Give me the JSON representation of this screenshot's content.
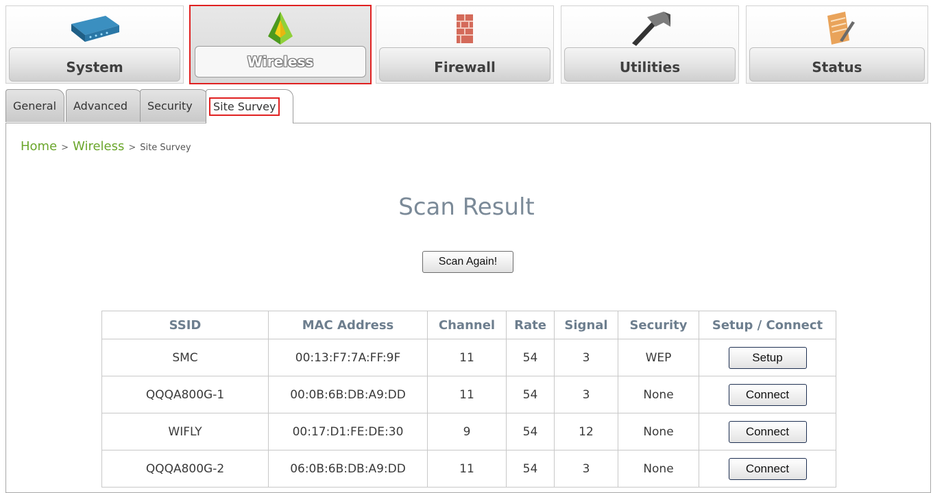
{
  "topnav": {
    "items": [
      {
        "label": "System",
        "icon": "router-icon"
      },
      {
        "label": "Wireless",
        "icon": "antenna-pyramid-icon",
        "active": true
      },
      {
        "label": "Firewall",
        "icon": "brick-wall-icon"
      },
      {
        "label": "Utilities",
        "icon": "hammer-icon"
      },
      {
        "label": "Status",
        "icon": "notepad-pencil-icon"
      }
    ]
  },
  "subtabs": {
    "items": [
      {
        "label": "General"
      },
      {
        "label": "Advanced"
      },
      {
        "label": "Security"
      },
      {
        "label": "Site Survey",
        "active": true
      }
    ]
  },
  "breadcrumb": {
    "home": "Home",
    "sep1": ">",
    "section": "Wireless",
    "sep2": ">",
    "current": "Site Survey"
  },
  "main": {
    "title": "Scan Result",
    "scan_button": "Scan Again!"
  },
  "table": {
    "headers": [
      "SSID",
      "MAC Address",
      "Channel",
      "Rate",
      "Signal",
      "Security",
      "Setup / Connect"
    ],
    "rows": [
      {
        "ssid": "SMC",
        "mac": "00:13:F7:7A:FF:9F",
        "channel": "11",
        "rate": "54",
        "signal": "3",
        "security": "WEP",
        "action": "Setup"
      },
      {
        "ssid": "QQQA800G-1",
        "mac": "00:0B:6B:DB:A9:DD",
        "channel": "11",
        "rate": "54",
        "signal": "3",
        "security": "None",
        "action": "Connect"
      },
      {
        "ssid": "WIFLY",
        "mac": "00:17:D1:FE:DE:30",
        "channel": "9",
        "rate": "54",
        "signal": "12",
        "security": "None",
        "action": "Connect"
      },
      {
        "ssid": "QQQA800G-2",
        "mac": "06:0B:6B:DB:A9:DD",
        "channel": "11",
        "rate": "54",
        "signal": "3",
        "security": "None",
        "action": "Connect"
      }
    ]
  },
  "colors": {
    "highlight": "#e02020",
    "breadcrumb_link": "#6aa62b",
    "header_text": "#6d7e8e"
  }
}
